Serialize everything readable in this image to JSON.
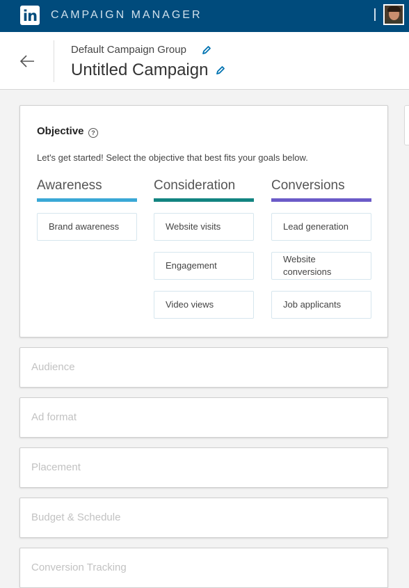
{
  "topbar": {
    "logo_text": "in",
    "app_title": "CAMPAIGN MANAGER",
    "colors": {
      "background": "#004b7c"
    }
  },
  "header": {
    "group_name": "Default Campaign Group",
    "campaign_name": "Untitled Campaign",
    "icons": {
      "back": "arrow-left-icon",
      "edit": "pencil-icon"
    }
  },
  "objective": {
    "title": "Objective",
    "help_icon": "?",
    "subtitle": "Let's get started! Select the objective that best fits your goals below.",
    "columns": [
      {
        "heading": "Awareness",
        "color": "#3aa8d6",
        "options": [
          "Brand awareness"
        ]
      },
      {
        "heading": "Consideration",
        "color": "#138481",
        "options": [
          "Website visits",
          "Engagement",
          "Video views"
        ]
      },
      {
        "heading": "Conversions",
        "color": "#6b5bc8",
        "options": [
          "Lead generation",
          "Website conversions",
          "Job applicants"
        ]
      }
    ]
  },
  "sections": [
    {
      "label": "Audience"
    },
    {
      "label": "Ad format"
    },
    {
      "label": "Placement"
    },
    {
      "label": "Budget & Schedule"
    },
    {
      "label": "Conversion Tracking"
    }
  ]
}
